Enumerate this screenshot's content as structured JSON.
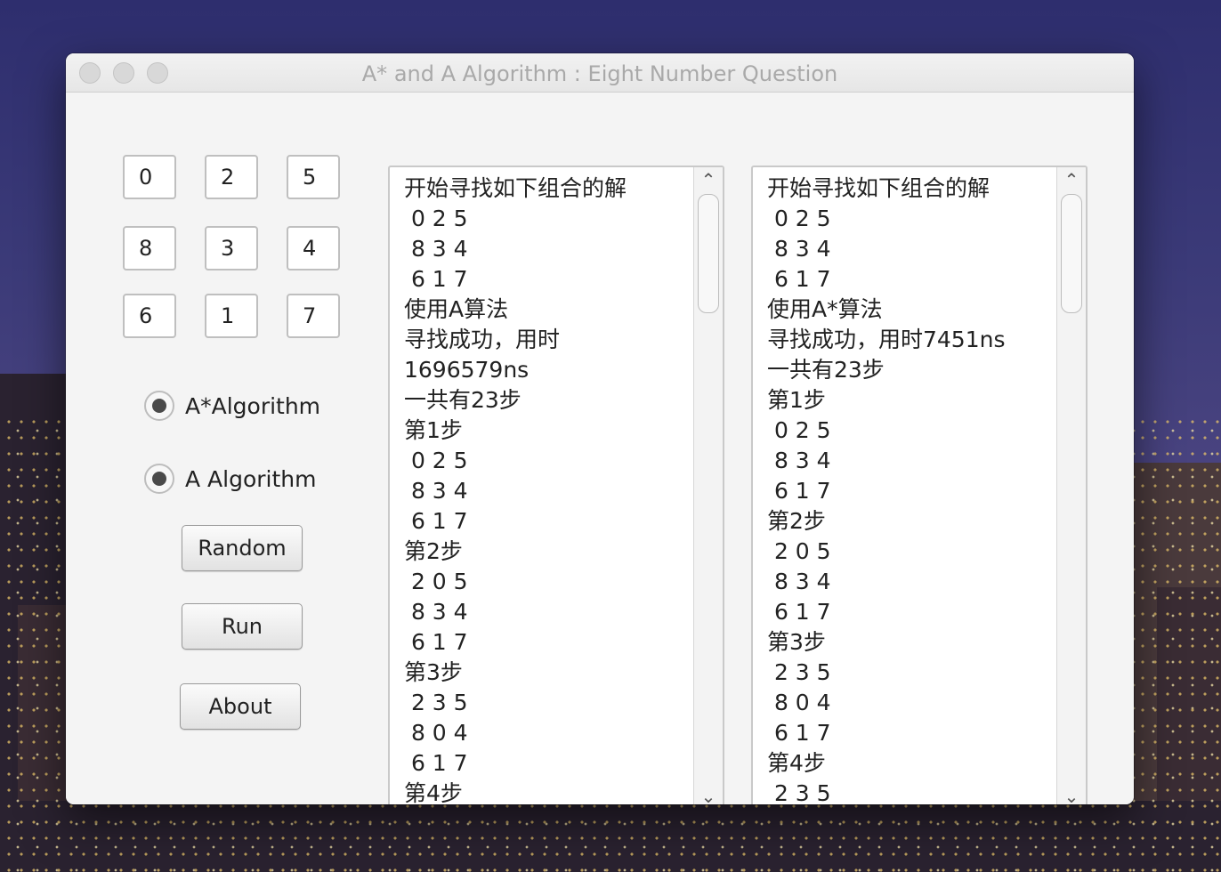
{
  "window": {
    "title": "A* and A Algorithm : Eight Number Question"
  },
  "grid": {
    "tiles": [
      "0",
      "2",
      "5",
      "8",
      "3",
      "4",
      "6",
      "1",
      "7"
    ]
  },
  "radios": {
    "a_star": "A*Algorithm",
    "a": "A Algorithm"
  },
  "buttons": {
    "random": "Random",
    "run": "Run",
    "about": "About"
  },
  "left_output": {
    "lines": [
      "开始寻找如下组合的解",
      " 0 2 5",
      " 8 3 4",
      " 6 1 7",
      "使用A算法",
      "寻找成功，用时",
      "1696579ns",
      "一共有23步",
      "第1步",
      " 0 2 5",
      " 8 3 4",
      " 6 1 7",
      "第2步",
      " 2 0 5",
      " 8 3 4",
      " 6 1 7",
      "第3步",
      " 2 3 5",
      " 8 0 4",
      " 6 1 7",
      "第4步"
    ]
  },
  "right_output": {
    "lines": [
      "开始寻找如下组合的解",
      " 0 2 5",
      " 8 3 4",
      " 6 1 7",
      "使用A*算法",
      "寻找成功，用时7451ns",
      "一共有23步",
      "第1步",
      " 0 2 5",
      " 8 3 4",
      " 6 1 7",
      "第2步",
      " 2 0 5",
      " 8 3 4",
      " 6 1 7",
      "第3步",
      " 2 3 5",
      " 8 0 4",
      " 6 1 7",
      "第4步",
      " 2 3 5"
    ]
  },
  "icons": {
    "scroll_up": "chevron-up-icon",
    "scroll_down": "chevron-down-icon"
  }
}
